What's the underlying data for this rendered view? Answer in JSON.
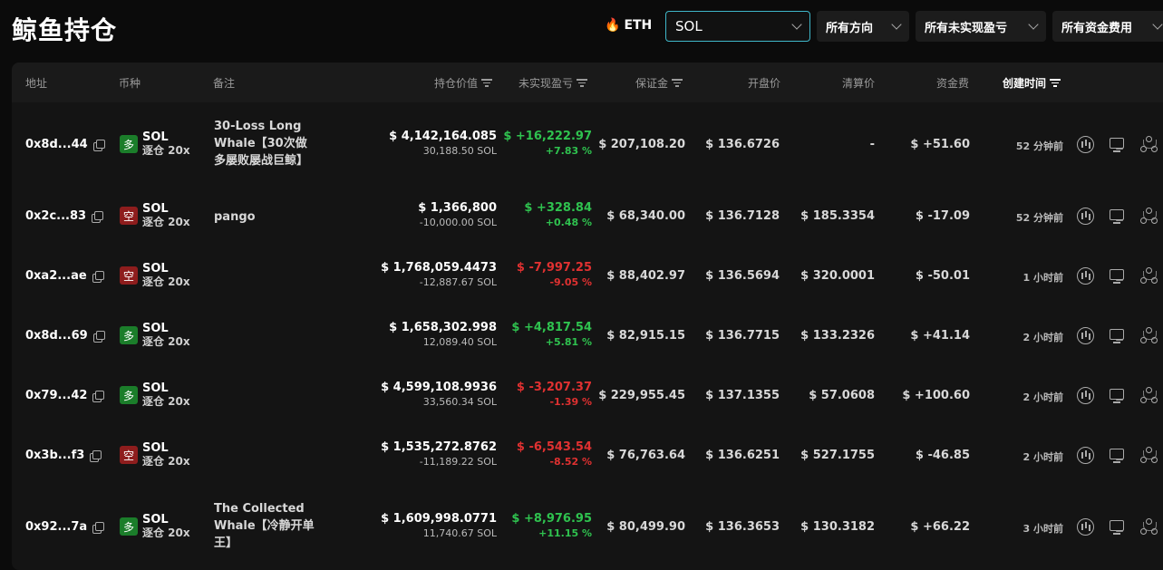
{
  "title": "鲸鱼持仓",
  "filters": {
    "eth": {
      "icon": "fire-icon",
      "label": "ETH"
    },
    "symbol_value": "SOL",
    "direction": "所有方向",
    "unrealized": "所有未实现盈亏",
    "funding": "所有资金费用"
  },
  "columns": {
    "address": "地址",
    "coin": "币种",
    "note": "备注",
    "value": "持仓价值",
    "pnl": "未实现盈亏",
    "margin": "保证金",
    "open_price": "开盘价",
    "liq_price": "清算价",
    "funding": "资金费",
    "created": "创建时间"
  },
  "colors": {
    "long": "#1b7d2a",
    "short": "#8e1d1d",
    "profit": "#2fc24f",
    "loss": "#e03131",
    "accent": "#3fb7c9"
  },
  "rows": [
    {
      "address": "0x8d...44",
      "side": "多",
      "side_type": "long",
      "symbol": "SOL",
      "mode": "逐仓 20x",
      "note": "30-Loss Long Whale【30次做多屡败屡战巨鲸】",
      "value": "$ 4,142,164.085",
      "size": "30,188.50 SOL",
      "pnl": "$ +16,222.97",
      "pnl_pct": "+7.83 %",
      "pnl_sign": "green",
      "margin": "$ 207,108.20",
      "open": "$ 136.6726",
      "liq": "-",
      "funding": "$ +51.60",
      "funding_sign": "green",
      "time": "52 分钟前"
    },
    {
      "address": "0x2c...83",
      "side": "空",
      "side_type": "short",
      "symbol": "SOL",
      "mode": "逐仓 20x",
      "note": "pango",
      "value": "$ 1,366,800",
      "size": "-10,000.00 SOL",
      "pnl": "$ +328.84",
      "pnl_pct": "+0.48 %",
      "pnl_sign": "green",
      "margin": "$ 68,340.00",
      "open": "$ 136.7128",
      "liq": "$ 185.3354",
      "funding": "$ -17.09",
      "funding_sign": "red",
      "time": "52 分钟前"
    },
    {
      "address": "0xa2...ae",
      "side": "空",
      "side_type": "short",
      "symbol": "SOL",
      "mode": "逐仓 20x",
      "note": "",
      "value": "$ 1,768,059.4473",
      "size": "-12,887.67 SOL",
      "pnl": "$ -7,997.25",
      "pnl_pct": "-9.05 %",
      "pnl_sign": "red",
      "margin": "$ 88,402.97",
      "open": "$ 136.5694",
      "liq": "$ 320.0001",
      "funding": "$ -50.01",
      "funding_sign": "red",
      "time": "1 小时前"
    },
    {
      "address": "0x8d...69",
      "side": "多",
      "side_type": "long",
      "symbol": "SOL",
      "mode": "逐仓 20x",
      "note": "",
      "value": "$ 1,658,302.998",
      "size": "12,089.40 SOL",
      "pnl": "$ +4,817.54",
      "pnl_pct": "+5.81 %",
      "pnl_sign": "green",
      "margin": "$ 82,915.15",
      "open": "$ 136.7715",
      "liq": "$ 133.2326",
      "funding": "$ +41.14",
      "funding_sign": "green",
      "time": "2 小时前"
    },
    {
      "address": "0x79...42",
      "side": "多",
      "side_type": "long",
      "symbol": "SOL",
      "mode": "逐仓 20x",
      "note": "",
      "value": "$ 4,599,108.9936",
      "size": "33,560.34 SOL",
      "pnl": "$ -3,207.37",
      "pnl_pct": "-1.39 %",
      "pnl_sign": "red",
      "margin": "$ 229,955.45",
      "open": "$ 137.1355",
      "liq": "$ 57.0608",
      "funding": "$ +100.60",
      "funding_sign": "green",
      "time": "2 小时前"
    },
    {
      "address": "0x3b...f3",
      "side": "空",
      "side_type": "short",
      "symbol": "SOL",
      "mode": "逐仓 20x",
      "note": "",
      "value": "$ 1,535,272.8762",
      "size": "-11,189.22 SOL",
      "pnl": "$ -6,543.54",
      "pnl_pct": "-8.52 %",
      "pnl_sign": "red",
      "margin": "$ 76,763.64",
      "open": "$ 136.6251",
      "liq": "$ 527.1755",
      "funding": "$ -46.85",
      "funding_sign": "red",
      "time": "2 小时前"
    },
    {
      "address": "0x92...7a",
      "side": "多",
      "side_type": "long",
      "symbol": "SOL",
      "mode": "逐仓 20x",
      "note": "The Collected Whale【冷静开单王】",
      "value": "$ 1,609,998.0771",
      "size": "11,740.67 SOL",
      "pnl": "$ +8,976.95",
      "pnl_pct": "+11.15 %",
      "pnl_sign": "green",
      "margin": "$ 80,499.90",
      "open": "$ 136.3653",
      "liq": "$ 130.3182",
      "funding": "$ +66.22",
      "funding_sign": "green",
      "time": "3 小时前"
    }
  ]
}
